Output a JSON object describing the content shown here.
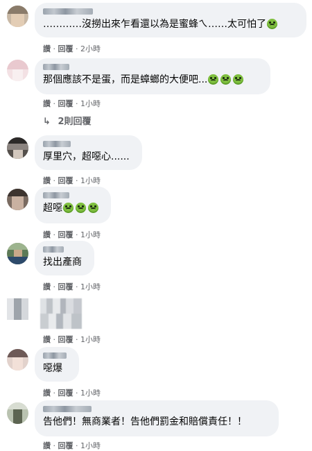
{
  "comments": [
    {
      "text": "…………沒撈出來乍看還以為是蜜蜂ㄟ……太可怕了",
      "emoji_count": 1,
      "like": "讚",
      "reply": "回覆",
      "sep": "·",
      "time": "2小時"
    },
    {
      "text": "那個應該不是蛋，而是蟑螂的大便吧...",
      "emoji_count": 3,
      "like": "讚",
      "reply": "回覆",
      "sep": "·",
      "time": "1小時"
    },
    {
      "text": "厚里穴，超噁心......",
      "emoji_count": 0,
      "like": "讚",
      "reply": "回覆",
      "sep": "·",
      "time": "1小時"
    },
    {
      "text": "超噁",
      "emoji_count": 3,
      "like": "讚",
      "reply": "回覆",
      "sep": "·",
      "time": "1小時"
    },
    {
      "text": "找出產商",
      "emoji_count": 0,
      "like": "讚",
      "reply": "回覆",
      "sep": "·",
      "time": "1小時"
    },
    {
      "text": "",
      "emoji_count": 0,
      "like": "讚",
      "reply": "回覆",
      "sep": "·",
      "time": "1小時"
    },
    {
      "text": "噁爆",
      "emoji_count": 0,
      "like": "讚",
      "reply": "回覆",
      "sep": "·",
      "time": "1小時"
    },
    {
      "text": "告他們！無商業者！告他們罰金和賠償責任！！",
      "emoji_count": 0,
      "like": "讚",
      "reply": "回覆",
      "sep": "·",
      "time": "1小時"
    }
  ],
  "replies_link": {
    "arrow": "↳",
    "label": "2則回覆"
  },
  "emoji_icon": "nauseated-face-icon"
}
